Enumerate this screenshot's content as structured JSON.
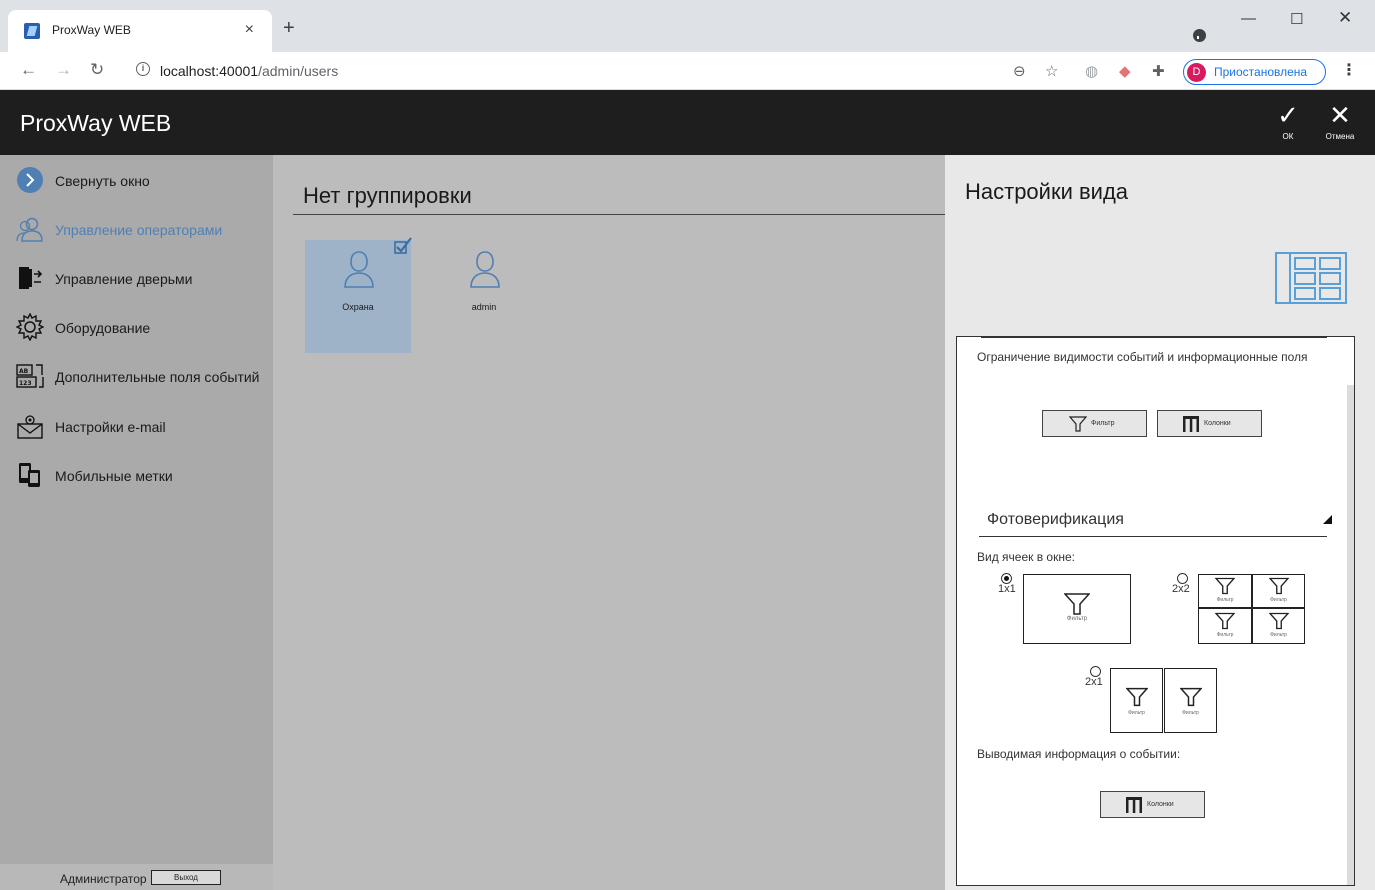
{
  "browser": {
    "tab_title": "ProxWay WEB",
    "tab_close": "×",
    "new_tab": "+",
    "url_host": "localhost:40001",
    "url_path": "/admin/users",
    "profile_initial": "D",
    "profile_status": "Приостановлена",
    "icons": [
      "back-arrow-icon",
      "forward-arrow-icon",
      "reload-icon",
      "info-icon",
      "zoom-icon",
      "star-icon",
      "globe-icon",
      "extension-icon",
      "puzzle-icon",
      "menu-icon"
    ]
  },
  "app": {
    "title": "ProxWay WEB",
    "ok_label": "ОК",
    "cancel_label": "Отмена"
  },
  "sidebar": {
    "items": [
      {
        "label": "Свернуть окно",
        "icon": "collapse-arrow-icon"
      },
      {
        "label": "Управление операторами",
        "icon": "operators-icon",
        "active": true
      },
      {
        "label": "Управление дверьми",
        "icon": "door-icon"
      },
      {
        "label": "Оборудование",
        "icon": "gear-icon"
      },
      {
        "label": "Дополнительные поля событий",
        "icon": "fields-icon"
      },
      {
        "label": "Настройки e-mail",
        "icon": "email-settings-icon"
      },
      {
        "label": "Мобильные метки",
        "icon": "mobile-tags-icon"
      }
    ],
    "user": "Администратор",
    "logout": "Выход"
  },
  "main": {
    "group_title": "Нет группировки",
    "tiles": [
      {
        "label": "Охрана",
        "selected": true
      },
      {
        "label": "admin",
        "selected": false
      }
    ]
  },
  "panel": {
    "title": "Настройки вида",
    "visibility_label": "Ограничение видимости событий и информационные поля",
    "filter_label": "Фильтр",
    "columns_label": "Колонки",
    "photo_section": "Фотоверификация",
    "cells_label": "Вид ячеек в окне:",
    "layouts": [
      {
        "label": "1x1",
        "selected": true
      },
      {
        "label": "2x2",
        "selected": false
      },
      {
        "label": "2x1",
        "selected": false
      }
    ],
    "cell_filter_label": "Фильтр",
    "event_info_label": "Выводимая информация о событии:",
    "event_columns_label": "Колонки"
  },
  "colors": {
    "header_bg": "#1e1e1e",
    "sidebar_bg": "#aaaaaa",
    "main_bg": "#bcbcbc",
    "selected_tile": "#9fb3c8",
    "accent": "#4f7fb3",
    "layout_icon": "#5aa0d8"
  }
}
